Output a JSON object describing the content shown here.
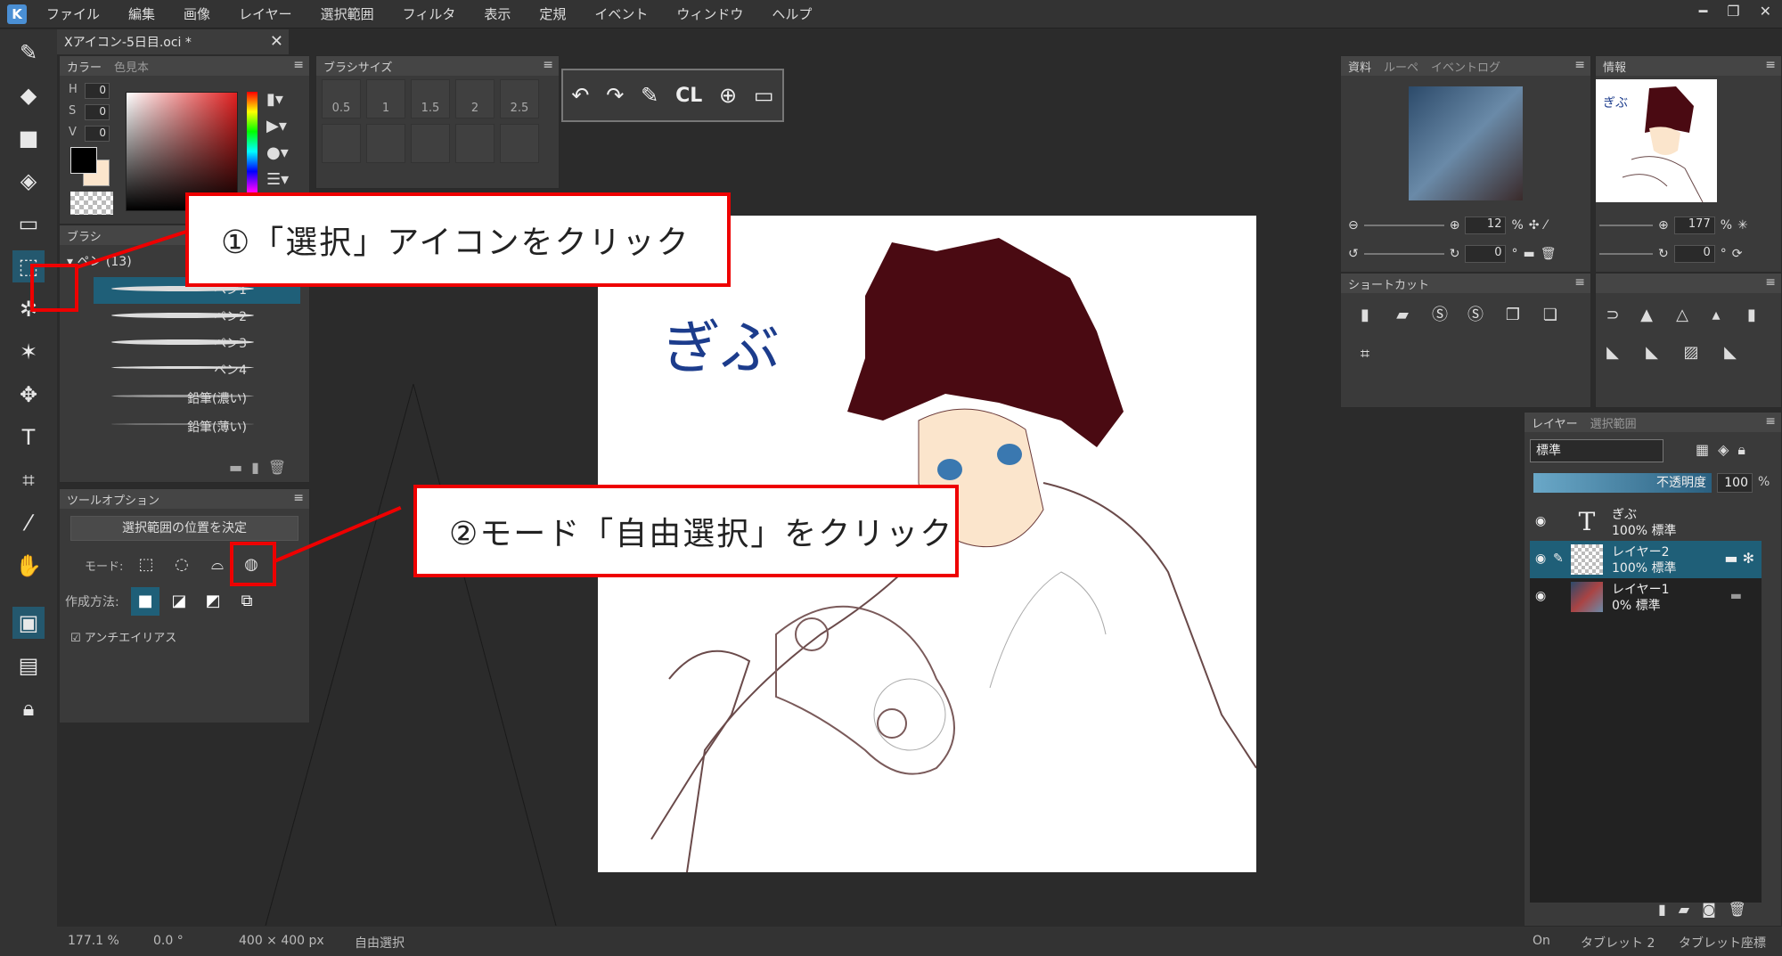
{
  "menubar": {
    "items": [
      "ファイル",
      "編集",
      "画像",
      "レイヤー",
      "選択範囲",
      "フィルタ",
      "表示",
      "定規",
      "イベント",
      "ウィンドウ",
      "ヘルプ"
    ],
    "win_min": "━",
    "win_max": "❐",
    "win_close": "✕"
  },
  "document_tab": {
    "title": "Xアイコン-5日目.oci *",
    "close": "✕"
  },
  "color_panel": {
    "tab_active": "カラー",
    "tab_inactive": "色見本",
    "h_label": "H",
    "h_value": "0",
    "s_label": "S",
    "s_value": "0",
    "v_label": "V",
    "v_value": "0",
    "fg_color": "#000000",
    "bg_color": "#fbe5cc"
  },
  "brushsize_panel": {
    "title": "ブラシサイズ",
    "sizes": [
      "0.5",
      "1",
      "1.5",
      "2",
      "2.5"
    ]
  },
  "quick_toolbar": {
    "cl_label": "CL"
  },
  "brush_panel": {
    "title": "ブラシ",
    "group": "ペン (13)",
    "items": [
      "ペン1",
      "ペン2",
      "ペン3",
      "ペン4",
      "鉛筆(濃い)",
      "鉛筆(薄い)"
    ]
  },
  "tool_options": {
    "title": "ツールオプション",
    "confirm_button": "選択範囲の位置を決定",
    "mode_label": "モード:",
    "method_label": "作成方法:",
    "antialias_label": "アンチエイリアス"
  },
  "navigator_panel": {
    "tabs": [
      "資料",
      "ルーペ",
      "イベントログ"
    ],
    "zoom": "12",
    "zoom_unit": "%",
    "rotation": "0",
    "rotation_unit": "°"
  },
  "info_panel": {
    "title": "情報",
    "zoom": "177",
    "zoom_unit": "%",
    "rotation": "0",
    "rotation_unit": "°",
    "thumb_text": "ぎぶ"
  },
  "shortcut_panel": {
    "title": "ショートカット"
  },
  "layer_panel": {
    "tabs": [
      "レイヤー",
      "選択範囲"
    ],
    "blend_mode": "標準",
    "opacity_label": "不透明度",
    "opacity_value": "100",
    "opacity_unit": "%",
    "layers": [
      {
        "name": "ぎぶ",
        "meta": "100% 標準",
        "selected": false
      },
      {
        "name": "レイヤー2",
        "meta": "100% 標準",
        "selected": true
      },
      {
        "name": "レイヤー1",
        "meta": "0% 標準",
        "selected": false
      }
    ]
  },
  "document": {
    "text": "ぎぶ"
  },
  "statusbar": {
    "zoom": "177.1 %",
    "rotation": "0.0 °",
    "size": "400 × 400 px",
    "mode": "自由選択",
    "on": "On",
    "tablet": "タブレット 2",
    "tablet_coords": "タブレット座標"
  },
  "annotations": {
    "step1": "①「選択」アイコンをクリック",
    "step2": "②モード「自由選択」をクリック",
    "color": "#e00000"
  }
}
